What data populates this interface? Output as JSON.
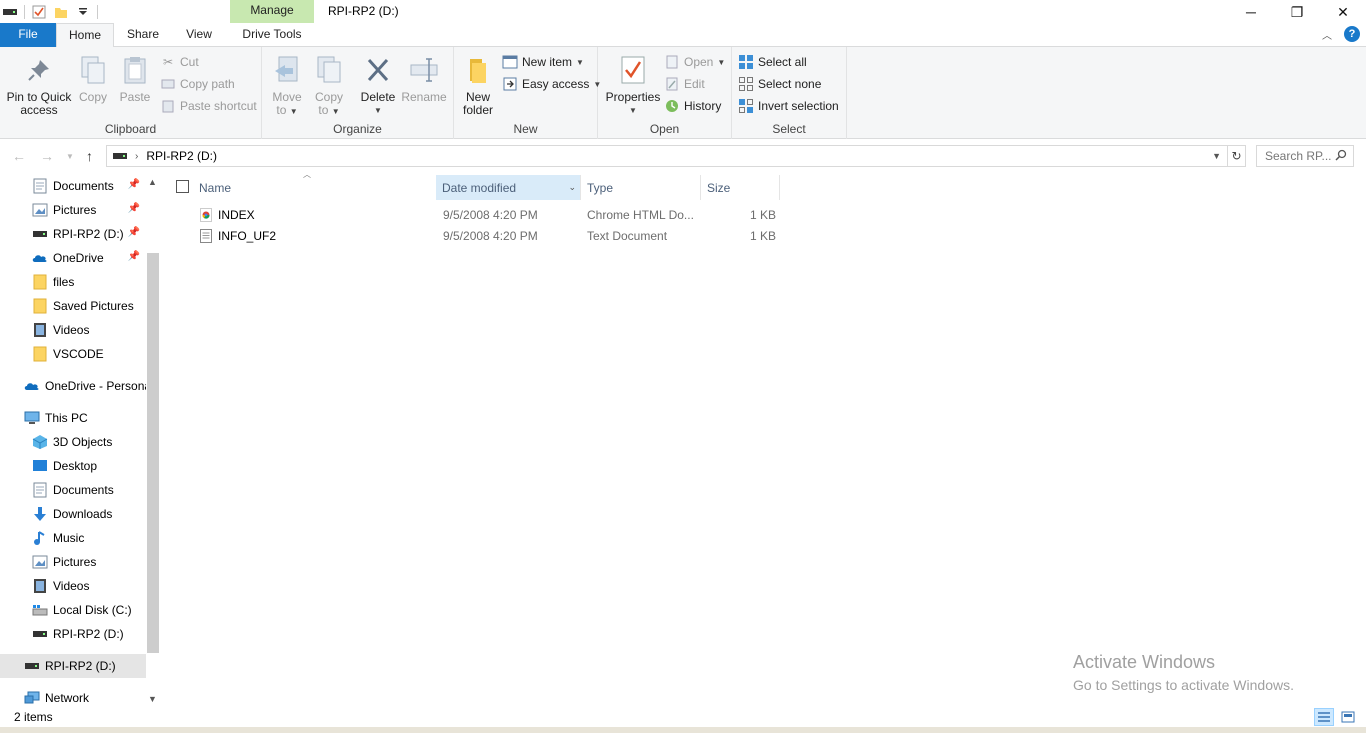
{
  "window": {
    "title": "RPI-RP2 (D:)",
    "context_tab_group": "Manage",
    "controls": {
      "minimize": "─",
      "restore": "❐",
      "close": "✕"
    }
  },
  "ribbon_tabs": [
    "File",
    "Home",
    "Share",
    "View",
    "Drive Tools"
  ],
  "ribbon": {
    "clipboard": {
      "label": "Clipboard",
      "pin_line1": "Pin to Quick",
      "pin_line2": "access",
      "copy": "Copy",
      "paste": "Paste",
      "cut": "Cut",
      "copy_path": "Copy path",
      "paste_shortcut": "Paste shortcut"
    },
    "organize": {
      "label": "Organize",
      "move_line1": "Move",
      "move_line2": "to",
      "copy_line1": "Copy",
      "copy_line2": "to",
      "delete": "Delete",
      "rename": "Rename"
    },
    "new": {
      "label": "New",
      "new_folder_line1": "New",
      "new_folder_line2": "folder",
      "new_item": "New item",
      "easy_access": "Easy access"
    },
    "open": {
      "label": "Open",
      "properties": "Properties",
      "open": "Open",
      "edit": "Edit",
      "history": "History"
    },
    "select": {
      "label": "Select",
      "select_all": "Select all",
      "select_none": "Select none",
      "invert_selection": "Invert selection"
    }
  },
  "address": {
    "path": "RPI-RP2 (D:)",
    "search_placeholder": "Search RP..."
  },
  "nav_pane": {
    "items": [
      {
        "label": "Documents",
        "icon": "documents-icon",
        "pinned": true
      },
      {
        "label": "Pictures",
        "icon": "pictures-icon",
        "pinned": true
      },
      {
        "label": "RPI-RP2 (D:)",
        "icon": "drive-icon",
        "pinned": true
      },
      {
        "label": "OneDrive",
        "icon": "onedrive-icon",
        "pinned": true
      },
      {
        "label": "files",
        "icon": "folder-icon"
      },
      {
        "label": "Saved Pictures",
        "icon": "folder-icon"
      },
      {
        "label": "Videos",
        "icon": "videos-icon"
      },
      {
        "label": "VSCODE",
        "icon": "folder-icon"
      },
      {
        "label": "OneDrive - Persona",
        "icon": "onedrive-icon"
      },
      {
        "label": "This PC",
        "icon": "computer-icon"
      },
      {
        "label": "3D Objects",
        "icon": "3d-objects-icon"
      },
      {
        "label": "Desktop",
        "icon": "desktop-icon"
      },
      {
        "label": "Documents",
        "icon": "documents-icon"
      },
      {
        "label": "Downloads",
        "icon": "downloads-icon"
      },
      {
        "label": "Music",
        "icon": "music-icon"
      },
      {
        "label": "Pictures",
        "icon": "pictures-icon"
      },
      {
        "label": "Videos",
        "icon": "videos-icon"
      },
      {
        "label": "Local Disk (C:)",
        "icon": "local-disk-icon"
      },
      {
        "label": "RPI-RP2 (D:)",
        "icon": "drive-icon"
      },
      {
        "label": "RPI-RP2 (D:)",
        "icon": "drive-icon",
        "selected": true
      },
      {
        "label": "Network",
        "icon": "network-icon"
      }
    ]
  },
  "file_list": {
    "columns": [
      "Name",
      "Date modified",
      "Type",
      "Size"
    ],
    "sorted_column": "Date modified",
    "rows": [
      {
        "name": "INDEX",
        "date": "9/5/2008 4:20 PM",
        "type": "Chrome HTML Do...",
        "size": "1 KB",
        "icon": "chrome-html-icon"
      },
      {
        "name": "INFO_UF2",
        "date": "9/5/2008 4:20 PM",
        "type": "Text Document",
        "size": "1 KB",
        "icon": "text-document-icon"
      }
    ]
  },
  "watermark": {
    "line1": "Activate Windows",
    "line2": "Go to Settings to activate Windows."
  },
  "status": {
    "item_count": "2 items"
  },
  "colors": {
    "accent": "#1979ca",
    "manage_tab": "#c8e8b0",
    "sorted_header": "#d9ebf9",
    "nav_selected": "#e5e5e5"
  }
}
